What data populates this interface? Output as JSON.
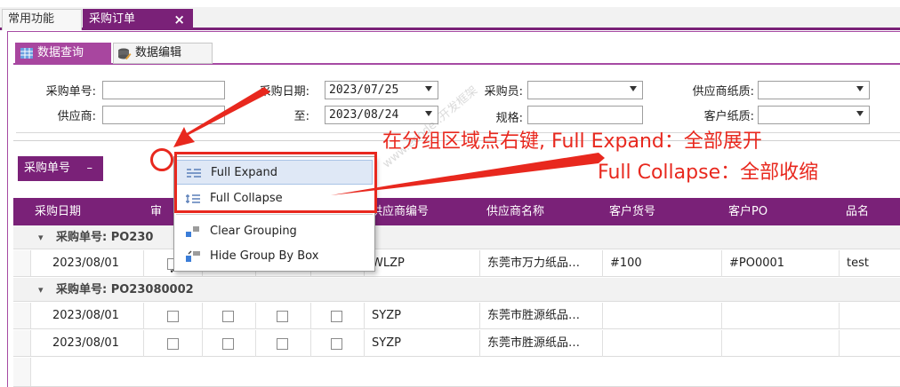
{
  "doc_tabs": [
    {
      "label": "常用功能"
    },
    {
      "label": "采购订单",
      "close": "×"
    }
  ],
  "sub_tabs": [
    {
      "label": "数据查询"
    },
    {
      "label": "数据编辑"
    }
  ],
  "filters": {
    "po_number_label": "采购单号:",
    "supplier_label": "供应商:",
    "purchase_date_label": "采购日期:",
    "to_label": "至:",
    "date_from": "2023/07/25",
    "date_to": "2023/08/24",
    "buyer_label": "采购员:",
    "spec_label": "规格:",
    "supplier_paper_label": "供应商纸质:",
    "customer_paper_label": "客户纸质:"
  },
  "group_chip": {
    "label": "采购单号",
    "mark": "–"
  },
  "columns": [
    "采购日期",
    "审",
    "",
    "",
    "",
    "供应商编号",
    "供应商名称",
    "客户货号",
    "客户PO",
    "品名"
  ],
  "groups": [
    {
      "label": "采购单号: PO230",
      "rows": [
        {
          "date": "2023/08/01",
          "checks": [
            true,
            false,
            false,
            false
          ],
          "supplier_code": "WLZP",
          "supplier_name": "东莞市万力纸品…",
          "customer_item": "#100",
          "customer_po": "#PO0001",
          "product": "test"
        }
      ]
    },
    {
      "label": "采购单号: PO23080002",
      "rows": [
        {
          "date": "2023/08/01",
          "checks": [
            false,
            false,
            false,
            false
          ],
          "supplier_code": "SYZP",
          "supplier_name": "东莞市胜源纸品…",
          "customer_item": "",
          "customer_po": "",
          "product": ""
        },
        {
          "date": "2023/08/01",
          "checks": [
            false,
            false,
            false,
            false
          ],
          "supplier_code": "SYZP",
          "supplier_name": "东莞市胜源纸品…",
          "customer_item": "",
          "customer_po": "",
          "product": ""
        }
      ]
    }
  ],
  "context_menu": {
    "full_expand": "Full Expand",
    "full_collapse": "Full Collapse",
    "clear_grouping": "Clear Grouping",
    "hide_group_by_box": "Hide Group By Box"
  },
  "annotation": {
    "line1": "在分组区域点右键, Full Expand：全部展开",
    "line2": "Full Collapse：全部收缩"
  },
  "watermark": "www.ecode..开发框架",
  "colors": {
    "accent": "#7a2178",
    "annotation": "#e8281e"
  }
}
